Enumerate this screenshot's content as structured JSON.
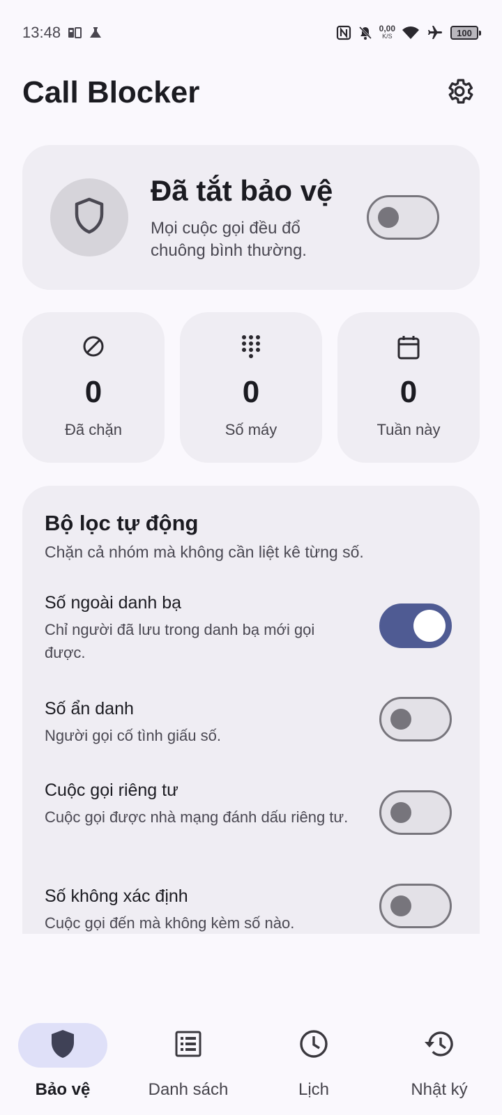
{
  "status_bar": {
    "time": "13:48",
    "net_speed_value": "0,00",
    "net_speed_unit": "K/S",
    "battery": "100"
  },
  "app_bar": {
    "title": "Call Blocker"
  },
  "protection": {
    "title": "Đã tắt bảo vệ",
    "description": "Mọi cuộc gọi đều đổ chuông bình thường.",
    "enabled": false
  },
  "stats": [
    {
      "icon": "block-icon",
      "value": "0",
      "label": "Đã chặn"
    },
    {
      "icon": "dialpad-icon",
      "value": "0",
      "label": "Số máy"
    },
    {
      "icon": "calendar-icon",
      "value": "0",
      "label": "Tuần này"
    }
  ],
  "filters": {
    "title": "Bộ lọc tự động",
    "description": "Chặn cả nhóm mà không cần liệt kê từng số.",
    "items": [
      {
        "name": "Số ngoài danh bạ",
        "description": "Chỉ người đã lưu trong danh bạ mới gọi được.",
        "enabled": true
      },
      {
        "name": "Số ẩn danh",
        "description": "Người gọi cố tình giấu số.",
        "enabled": false
      },
      {
        "name": "Cuộc gọi riêng tư",
        "description": "Cuộc gọi được nhà mạng đánh dấu riêng tư.",
        "enabled": false
      },
      {
        "name": "Số không xác định",
        "description": "Cuộc gọi đến mà không kèm số nào.",
        "enabled": false
      }
    ]
  },
  "bottom_nav": [
    {
      "label": "Bảo vệ",
      "icon": "shield-icon",
      "active": true
    },
    {
      "label": "Danh sách",
      "icon": "list-icon",
      "active": false
    },
    {
      "label": "Lịch",
      "icon": "clock-icon",
      "active": false
    },
    {
      "label": "Nhật ký",
      "icon": "history-icon",
      "active": false
    }
  ],
  "colors": {
    "background": "#faf8fd",
    "card": "#efedf3",
    "accent": "#4f5b93",
    "nav_active_pill": "#dfe0f8"
  }
}
